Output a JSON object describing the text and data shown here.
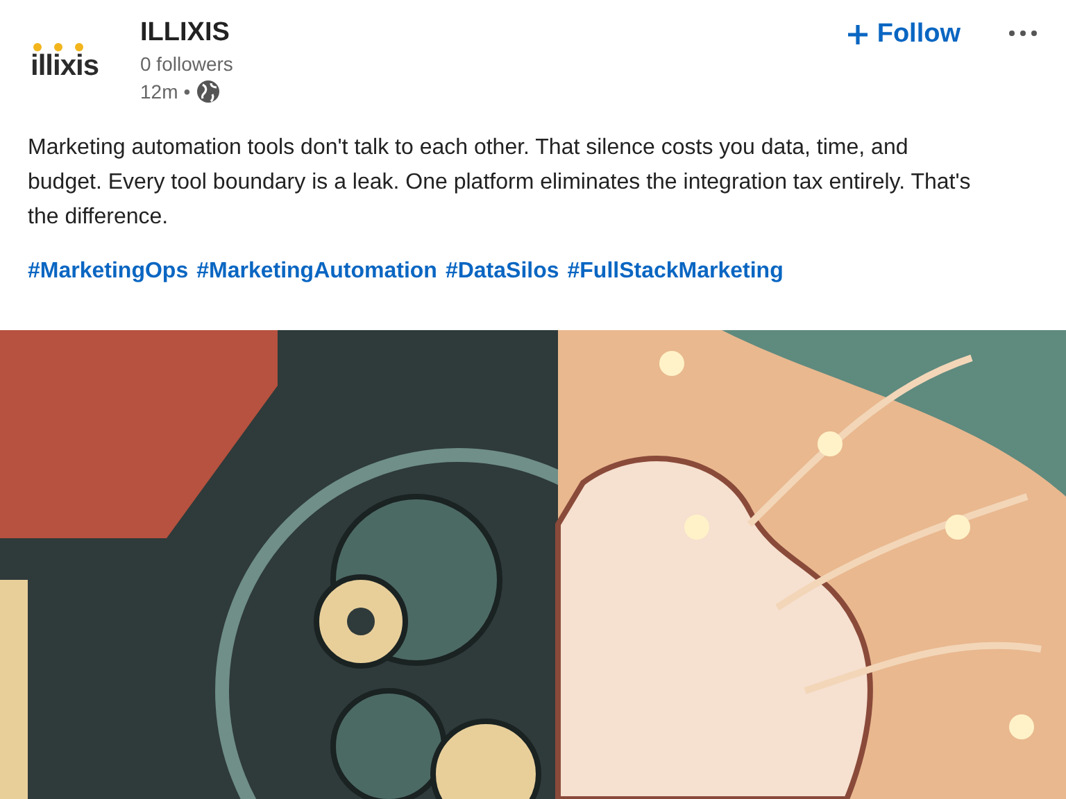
{
  "post": {
    "author": {
      "logo_text": "illixis",
      "name": "ILLIXIS",
      "followers": "0 followers",
      "time": "12m",
      "separator": "•"
    },
    "follow_button": {
      "label": "Follow"
    },
    "text": "Marketing automation tools don't talk to each other. That silence costs you data, time, and budget. Every tool boundary is a leak. One platform eliminates the integration tax entirely. That's the difference.",
    "hashtags": [
      "#MarketingOps",
      "#MarketingAutomation",
      "#DataSilos",
      "#FullStackMarketing"
    ]
  }
}
